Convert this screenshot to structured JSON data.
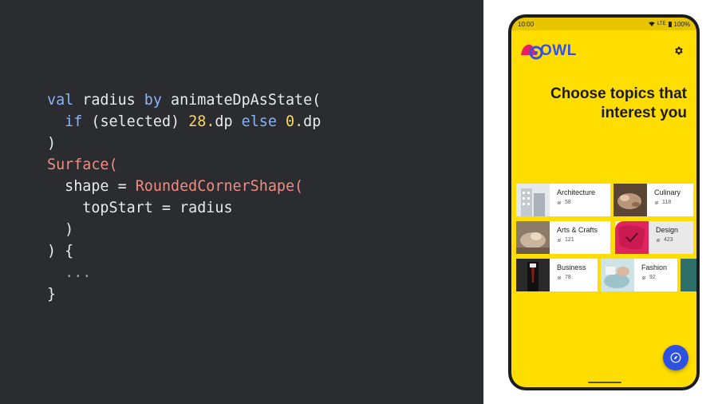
{
  "code": {
    "lines": [
      [
        {
          "t": "val",
          "c": "kw"
        },
        {
          "t": " radius ",
          "c": "plain"
        },
        {
          "t": "by",
          "c": "kw"
        },
        {
          "t": " animateDpAsState(",
          "c": "plain"
        }
      ],
      [
        {
          "t": "  ",
          "c": "plain"
        },
        {
          "t": "if",
          "c": "kw"
        },
        {
          "t": " (selected) ",
          "c": "plain"
        },
        {
          "t": "28.",
          "c": "num"
        },
        {
          "t": "dp ",
          "c": "plain"
        },
        {
          "t": "else",
          "c": "kw"
        },
        {
          "t": " ",
          "c": "plain"
        },
        {
          "t": "0.",
          "c": "num"
        },
        {
          "t": "dp",
          "c": "plain"
        }
      ],
      [
        {
          "t": ")",
          "c": "plain"
        }
      ],
      [
        {
          "t": "Surface(",
          "c": "type"
        }
      ],
      [
        {
          "t": "  shape = ",
          "c": "plain"
        },
        {
          "t": "RoundedCornerShape(",
          "c": "type"
        }
      ],
      [
        {
          "t": "    topStart = radius",
          "c": "plain"
        }
      ],
      [
        {
          "t": "  )",
          "c": "plain"
        }
      ],
      [
        {
          "t": ") {",
          "c": "plain"
        }
      ],
      [
        {
          "t": "  ...",
          "c": "muted"
        }
      ],
      [
        {
          "t": "}",
          "c": "plain"
        }
      ]
    ]
  },
  "phone": {
    "status_bar": {
      "time": "10:00",
      "network": "LTE",
      "battery": "100%"
    },
    "app": {
      "logo_text": "OWL",
      "headline_line1": "Choose topics that",
      "headline_line2": "interest you",
      "topics": [
        {
          "name": "Architecture",
          "count": "58",
          "thumb": "architecture"
        },
        {
          "name": "Culinary",
          "count": "118",
          "thumb": "culinary"
        },
        {
          "name": "Arts & Crafts",
          "count": "121",
          "thumb": "arts-crafts"
        },
        {
          "name": "Design",
          "count": "423",
          "thumb": "design",
          "selected": true
        },
        {
          "name": "Business",
          "count": "78",
          "thumb": "business"
        },
        {
          "name": "Fashion",
          "count": "92",
          "thumb": "fashion"
        }
      ],
      "fab_icon": "explore-icon"
    }
  },
  "colors": {
    "code_background": "#2b2c2f",
    "keyword": "#8ab4f8",
    "number": "#fdd663",
    "type": "#f28b82",
    "app_yellow": "#ffdd00",
    "accent_blue": "#2e50e3"
  }
}
